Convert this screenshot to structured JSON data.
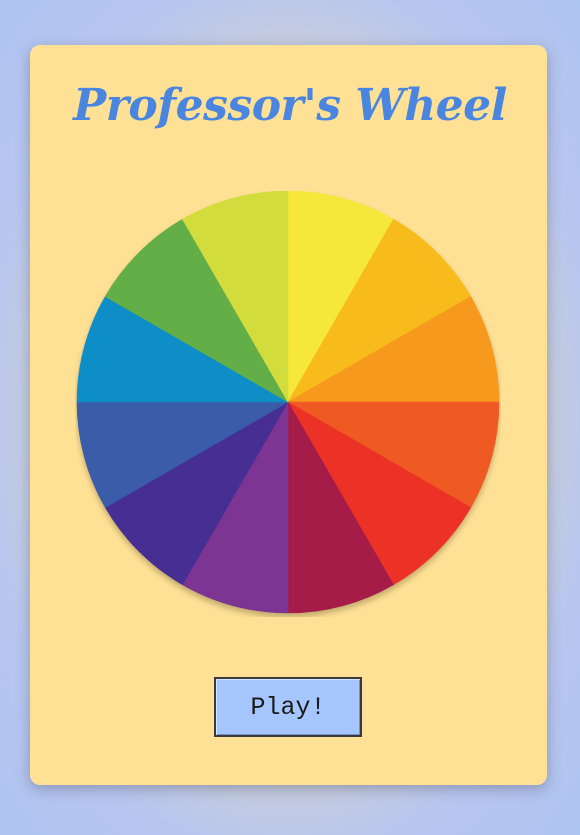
{
  "title": "Professor's Wheel",
  "play_button": {
    "label": "Play!"
  },
  "wheel": {
    "segments": [
      {
        "color": "#f6e73a"
      },
      {
        "color": "#f8bb1a"
      },
      {
        "color": "#f7991f"
      },
      {
        "color": "#ef5a24"
      },
      {
        "color": "#ec3226"
      },
      {
        "color": "#a61b48"
      },
      {
        "color": "#7b3592"
      },
      {
        "color": "#462f93"
      },
      {
        "color": "#3a5ca9"
      },
      {
        "color": "#0a8ec7"
      },
      {
        "color": "#64ae46"
      },
      {
        "color": "#d2dc3c"
      }
    ]
  },
  "colors": {
    "card_background": "#ffe196",
    "title": "#4a86e0",
    "button_background": "#a6c6ff"
  }
}
